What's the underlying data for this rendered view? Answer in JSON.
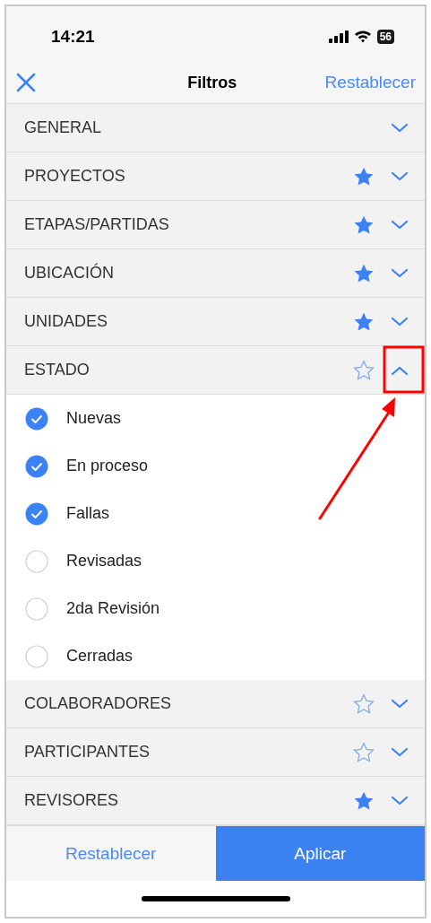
{
  "status_bar": {
    "time": "14:21",
    "battery": "56"
  },
  "nav": {
    "title": "Filtros",
    "reset": "Restablecer"
  },
  "sections": [
    {
      "label": "GENERAL",
      "expanded": false
    },
    {
      "label": "PROYECTOS",
      "starred": true,
      "expanded": false
    },
    {
      "label": "ETAPAS/PARTIDAS",
      "starred": true,
      "expanded": false
    },
    {
      "label": "UBICACIÓN",
      "starred": true,
      "expanded": false
    },
    {
      "label": "UNIDADES",
      "starred": true,
      "expanded": false
    },
    {
      "label": "ESTADO",
      "starred": false,
      "expanded": true,
      "options": [
        {
          "label": "Nuevas",
          "checked": true
        },
        {
          "label": "En proceso",
          "checked": true
        },
        {
          "label": "Fallas",
          "checked": true
        },
        {
          "label": "Revisadas",
          "checked": false
        },
        {
          "label": "2da Revisión",
          "checked": false
        },
        {
          "label": "Cerradas",
          "checked": false
        }
      ]
    },
    {
      "label": "COLABORADORES",
      "starred": false,
      "expanded": false
    },
    {
      "label": "PARTICIPANTES",
      "starred": false,
      "expanded": false
    },
    {
      "label": "REVISORES",
      "starred": true,
      "expanded": false
    }
  ],
  "footer": {
    "reset": "Restablecer",
    "apply": "Aplicar"
  },
  "annotation": {
    "shown": true
  }
}
